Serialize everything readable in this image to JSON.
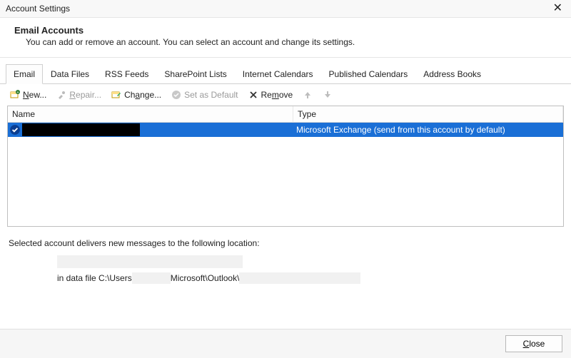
{
  "window": {
    "title": "Account Settings",
    "close_glyph": "✕"
  },
  "header": {
    "title": "Email Accounts",
    "subtitle": "You can add or remove an account. You can select an account and change its settings."
  },
  "tabs": [
    {
      "label": "Email",
      "active": true
    },
    {
      "label": "Data Files",
      "active": false
    },
    {
      "label": "RSS Feeds",
      "active": false
    },
    {
      "label": "SharePoint Lists",
      "active": false
    },
    {
      "label": "Internet Calendars",
      "active": false
    },
    {
      "label": "Published Calendars",
      "active": false
    },
    {
      "label": "Address Books",
      "active": false
    }
  ],
  "toolbar": {
    "new_prefix": "N",
    "new_rest": "ew...",
    "repair_prefix": "R",
    "repair_rest": "epair...",
    "change_prefix": "Ch",
    "change_u": "a",
    "change_rest": "nge...",
    "default_label": "Set as Default",
    "remove_prefix": "Re",
    "remove_u": "m",
    "remove_rest": "ove"
  },
  "columns": {
    "name": "Name",
    "type": "Type"
  },
  "accounts": [
    {
      "name": "",
      "type": "Microsoft Exchange (send from this account by default)",
      "default": true
    }
  ],
  "location": {
    "intro": "Selected account delivers new messages to the following location:",
    "line_prefix": "in data file C:\\Users",
    "line_mid": "Microsoft\\Outlook\\"
  },
  "footer": {
    "close_u": "C",
    "close_rest": "lose"
  }
}
